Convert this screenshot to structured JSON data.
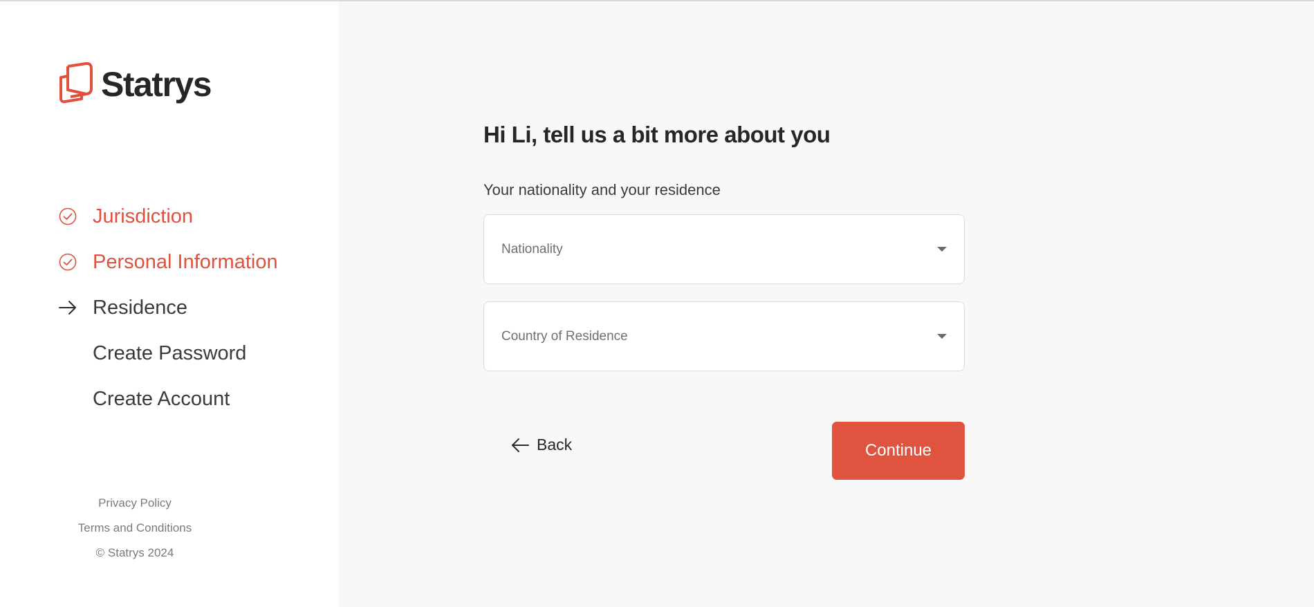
{
  "brand": {
    "name": "Statrys",
    "accent_color": "#e0533f"
  },
  "steps": [
    {
      "label": "Jurisdiction",
      "status": "done",
      "icon": "check-circle-icon"
    },
    {
      "label": "Personal Information",
      "status": "done",
      "icon": "check-circle-icon"
    },
    {
      "label": "Residence",
      "status": "current",
      "icon": "arrow-right-icon"
    },
    {
      "label": "Create Password",
      "status": "pending",
      "icon": ""
    },
    {
      "label": "Create Account",
      "status": "pending",
      "icon": ""
    }
  ],
  "footer": {
    "privacy": "Privacy Policy",
    "terms": "Terms and Conditions",
    "copyright": "© Statrys 2024"
  },
  "form": {
    "title": "Hi Li, tell us a bit more about you",
    "subtitle": "Your nationality and your residence",
    "nationality": {
      "placeholder": "Nationality",
      "value": ""
    },
    "residence": {
      "placeholder": "Country of Residence",
      "value": ""
    },
    "back_label": "Back",
    "continue_label": "Continue"
  }
}
